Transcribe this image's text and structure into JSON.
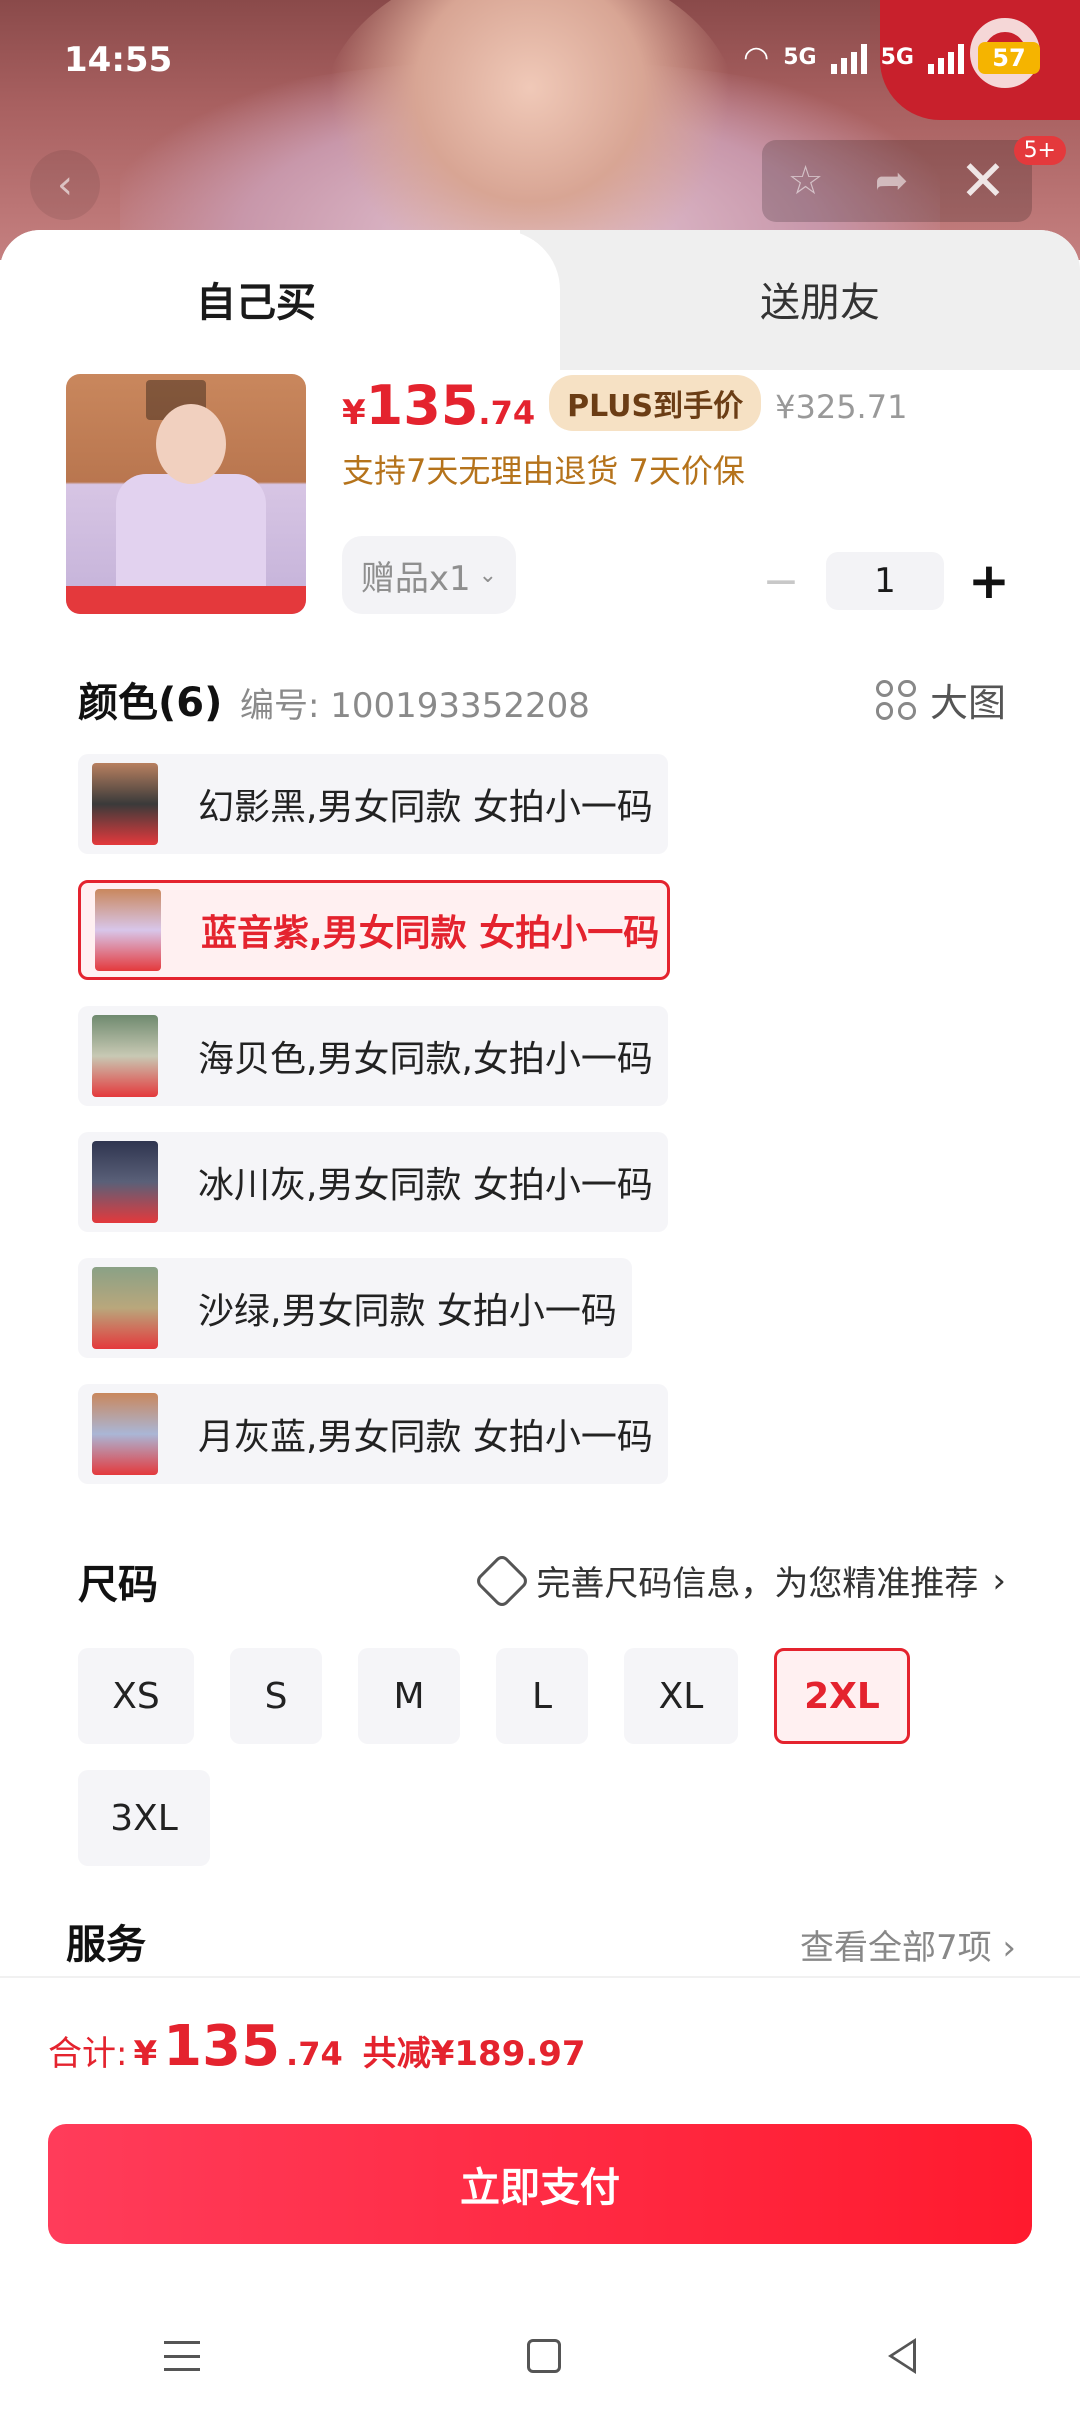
{
  "status_bar": {
    "time": "14:55",
    "network_1": "5G",
    "network_2": "5G",
    "battery": "57"
  },
  "top_nav": {
    "badge": "5+"
  },
  "tabs": {
    "self": "自己买",
    "gift": "送朋友"
  },
  "product": {
    "price_currency": "¥",
    "price_int": "135",
    "price_dec": ".74",
    "plus_tag": "PLUS到手价",
    "original_price": "¥325.71",
    "guarantee": "支持7天无理由退货  7天价保",
    "gift_label": "赠品x1",
    "quantity": "1"
  },
  "color_section": {
    "title": "颜色(6)",
    "sku": "编号: 100193352208",
    "big_pic": "大图",
    "options": [
      {
        "label": "幻影黑,男女同款 女拍小一码",
        "selected": false,
        "thumb_color": "#3a3a3a"
      },
      {
        "label": "蓝音紫,男女同款 女拍小一码",
        "selected": true,
        "thumb_color": "#d8c6ea"
      },
      {
        "label": "海贝色,男女同款,女拍小一码",
        "selected": false,
        "thumb_color": "#8fa38e"
      },
      {
        "label": "冰川灰,男女同款 女拍小一码",
        "selected": false,
        "thumb_color": "#5a6078"
      },
      {
        "label": "沙绿,男女同款 女拍小一码",
        "selected": false,
        "thumb_color": "#b9a77c"
      },
      {
        "label": "月灰蓝,男女同款 女拍小一码",
        "selected": false,
        "thumb_color": "#aab6d6"
      }
    ]
  },
  "size_section": {
    "title": "尺码",
    "note": "完善尺码信息，为您精准推荐",
    "options": [
      "XS",
      "S",
      "M",
      "L",
      "XL",
      "2XL",
      "3XL"
    ],
    "selected": "2XL"
  },
  "service": {
    "title": "服务",
    "more": "查看全部7项"
  },
  "total": {
    "label": "合计:",
    "currency": "¥",
    "int": "135",
    "dec": ".74",
    "savings": "共减¥189.97"
  },
  "pay_button": "立即支付",
  "colors": {
    "accent": "#e4232e",
    "gold": "#b5731b",
    "plus_bg": "#f6e1c4"
  }
}
